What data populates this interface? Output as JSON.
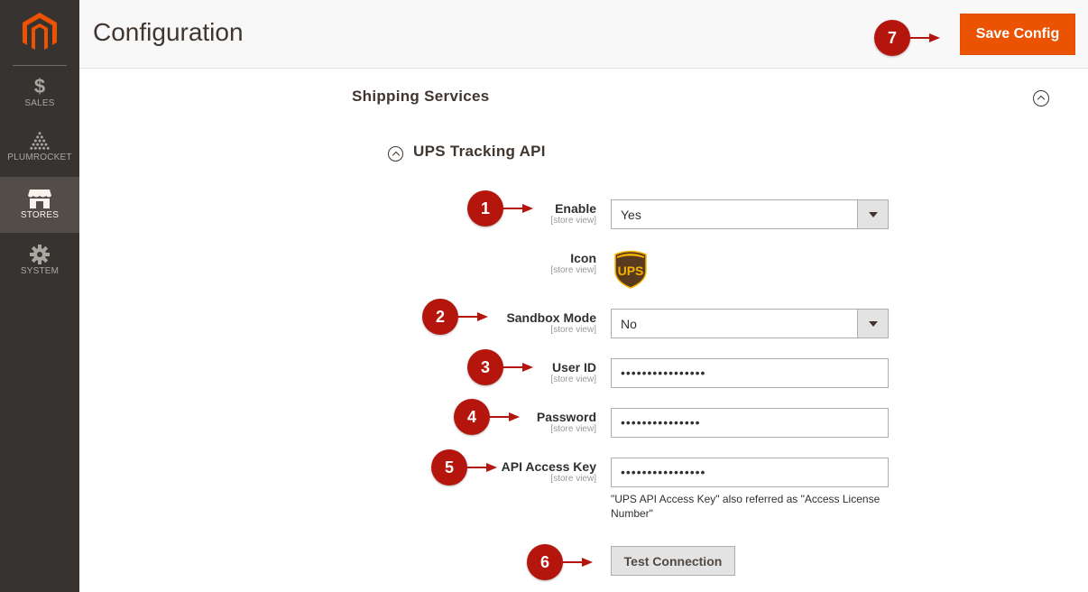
{
  "sidebar": {
    "items": [
      {
        "label": "SALES",
        "icon": "dollar-icon"
      },
      {
        "label": "PLUMROCKET",
        "icon": "plumrocket-icon"
      },
      {
        "label": "STORES",
        "icon": "store-icon",
        "active": true
      },
      {
        "label": "SYSTEM",
        "icon": "gear-icon"
      }
    ],
    "dollar_glyph": "$"
  },
  "header": {
    "title": "Configuration",
    "save_label": "Save Config"
  },
  "section": {
    "title": "Shipping Services",
    "subsection_title": "UPS Tracking API"
  },
  "form": {
    "enable": {
      "label": "Enable",
      "scope": "[store view]",
      "value": "Yes"
    },
    "icon": {
      "label": "Icon",
      "scope": "[store view]",
      "image_text": "UPS"
    },
    "sandbox": {
      "label": "Sandbox Mode",
      "scope": "[store view]",
      "value": "No"
    },
    "user_id": {
      "label": "User ID",
      "scope": "[store view]",
      "value": "••••••••••••••••"
    },
    "password": {
      "label": "Password",
      "scope": "[store view]",
      "value": "•••••••••••••••"
    },
    "api_key": {
      "label": "API Access Key",
      "scope": "[store view]",
      "value": "••••••••••••••••",
      "note": "\"UPS API Access Key\" also referred as \"Access License Number\""
    },
    "test_label": "Test Connection"
  },
  "callouts": [
    "1",
    "2",
    "3",
    "4",
    "5",
    "6",
    "7"
  ],
  "colors": {
    "accent": "#eb5202",
    "callout": "#b4150c",
    "sidebar": "#373330"
  }
}
